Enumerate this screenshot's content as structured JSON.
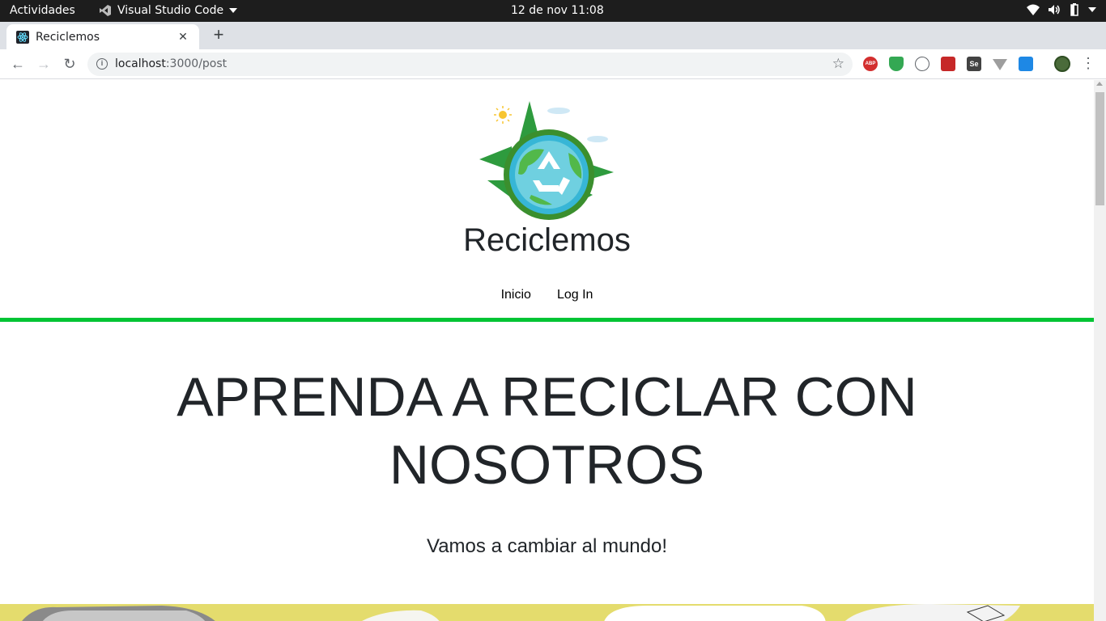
{
  "system_bar": {
    "activities": "Actividades",
    "app_name": "Visual Studio Code",
    "clock": "12 de nov  11:08"
  },
  "browser": {
    "tab_title": "Reciclemos",
    "url_host": "localhost",
    "url_rest": ":3000/post",
    "extension_abp_label": "ABP",
    "extension_se_label": "Se"
  },
  "site": {
    "title": "Reciclemos",
    "nav": [
      {
        "label": "Inicio"
      },
      {
        "label": "Log In"
      }
    ],
    "accent_color": "#00c434"
  },
  "hero": {
    "title": "APRENDA A RECICLAR CON NOSOTROS",
    "subtitle": "Vamos a cambiar al mundo!"
  }
}
